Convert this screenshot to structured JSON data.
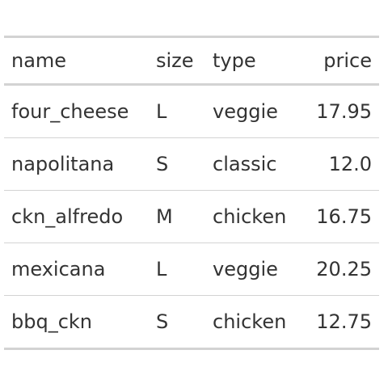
{
  "table": {
    "columns": [
      {
        "key": "name",
        "label": "name",
        "align": "left"
      },
      {
        "key": "size",
        "label": "size",
        "align": "left"
      },
      {
        "key": "type",
        "label": "type",
        "align": "left"
      },
      {
        "key": "price",
        "label": "price",
        "align": "right"
      }
    ],
    "rows": [
      {
        "name": "four_cheese",
        "size": "L",
        "type": "veggie",
        "price": "17.95"
      },
      {
        "name": "napolitana",
        "size": "S",
        "type": "classic",
        "price": "12.0"
      },
      {
        "name": "ckn_alfredo",
        "size": "M",
        "type": "chicken",
        "price": "16.75"
      },
      {
        "name": "mexicana",
        "size": "L",
        "type": "veggie",
        "price": "20.25"
      },
      {
        "name": "bbq_ckn",
        "size": "S",
        "type": "chicken",
        "price": "12.75"
      }
    ]
  },
  "colors": {
    "text": "#333333",
    "rule": "#d3d3d3",
    "background": "#ffffff"
  }
}
